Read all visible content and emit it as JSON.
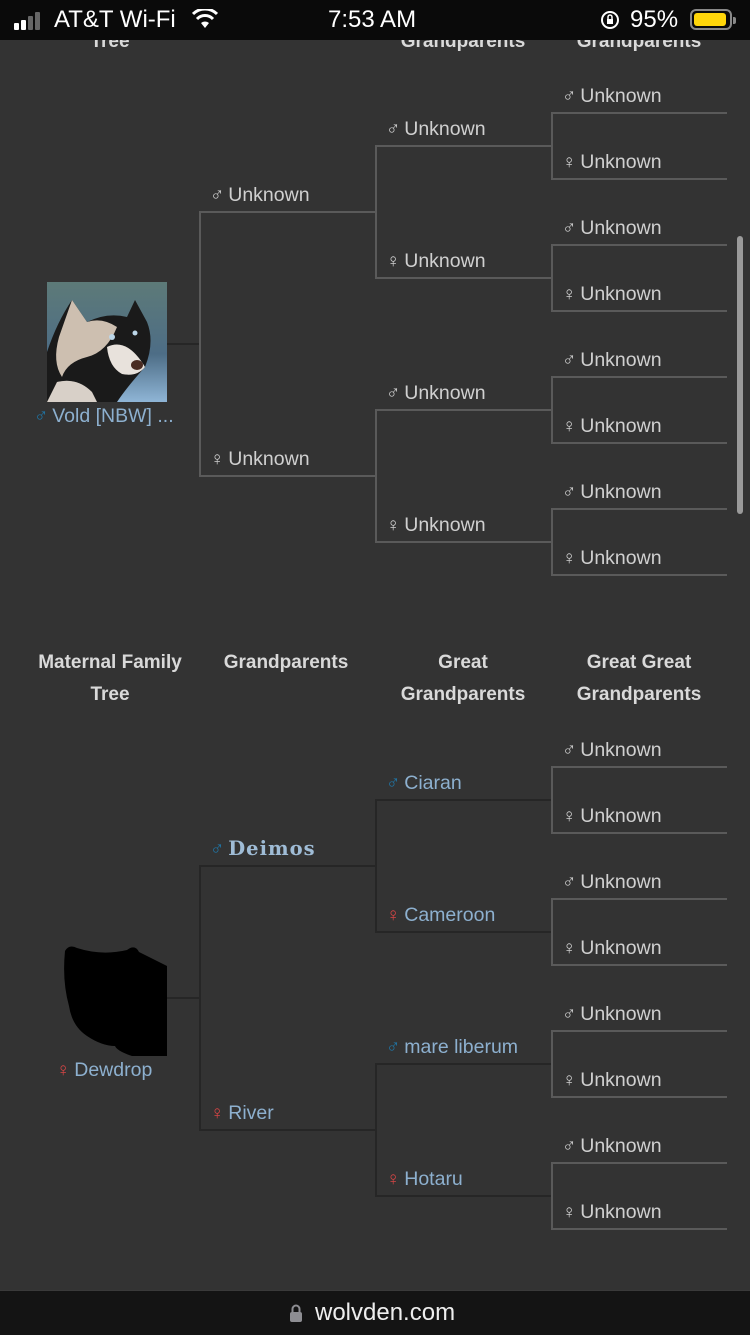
{
  "status_bar": {
    "carrier": "AT&T Wi-Fi",
    "time": "7:53 AM",
    "battery": "95%",
    "battery_level": 0.95,
    "battery_color": "#ffd60a"
  },
  "paternal_tree": {
    "headers": [
      "Tree",
      "",
      "Grandparents",
      "Grandparents"
    ],
    "subject": {
      "name": "Vold [NBW] ...",
      "sex": "male",
      "icon": "wolf-portrait"
    },
    "grandparents": [
      {
        "name": "Unknown",
        "sex": "male"
      },
      {
        "name": "Unknown",
        "sex": "female"
      }
    ],
    "great_grandparents": [
      {
        "name": "Unknown",
        "sex": "male"
      },
      {
        "name": "Unknown",
        "sex": "female"
      },
      {
        "name": "Unknown",
        "sex": "male"
      },
      {
        "name": "Unknown",
        "sex": "female"
      }
    ],
    "great_great_grandparents": [
      {
        "name": "Unknown",
        "sex": "male"
      },
      {
        "name": "Unknown",
        "sex": "female"
      },
      {
        "name": "Unknown",
        "sex": "male"
      },
      {
        "name": "Unknown",
        "sex": "female"
      },
      {
        "name": "Unknown",
        "sex": "male"
      },
      {
        "name": "Unknown",
        "sex": "female"
      },
      {
        "name": "Unknown",
        "sex": "male"
      },
      {
        "name": "Unknown",
        "sex": "female"
      }
    ]
  },
  "maternal_tree": {
    "headers": [
      "Maternal Family Tree",
      "Grandparents",
      "Great Grandparents",
      "Great Great Grandparents"
    ],
    "subject": {
      "name": "Dewdrop",
      "sex": "female",
      "icon": "wolf-silhouette"
    },
    "grandparents": [
      {
        "name": "Deimos",
        "sex": "male",
        "known": true
      },
      {
        "name": "River",
        "sex": "female",
        "known": true
      }
    ],
    "great_grandparents": [
      {
        "name": "Ciaran",
        "sex": "male",
        "known": true
      },
      {
        "name": "Cameroon",
        "sex": "female",
        "known": true
      },
      {
        "name": "mare liberum",
        "sex": "male",
        "known": true
      },
      {
        "name": "Hotaru",
        "sex": "female",
        "known": true
      }
    ],
    "great_great_grandparents": [
      {
        "name": "Unknown",
        "sex": "male"
      },
      {
        "name": "Unknown",
        "sex": "female"
      },
      {
        "name": "Unknown",
        "sex": "male"
      },
      {
        "name": "Unknown",
        "sex": "female"
      },
      {
        "name": "Unknown",
        "sex": "male"
      },
      {
        "name": "Unknown",
        "sex": "female"
      },
      {
        "name": "Unknown",
        "sex": "male"
      },
      {
        "name": "Unknown",
        "sex": "female"
      }
    ]
  },
  "symbols": {
    "male": "♂",
    "female": "♀"
  },
  "colors": {
    "male": "#1f77a8",
    "female": "#d64545",
    "known_name": "#8db0cf",
    "unknown_name": "#d0d0d0",
    "background": "#333333"
  },
  "url_bar": {
    "domain": "wolvden.com",
    "icon": "padlock-icon"
  }
}
